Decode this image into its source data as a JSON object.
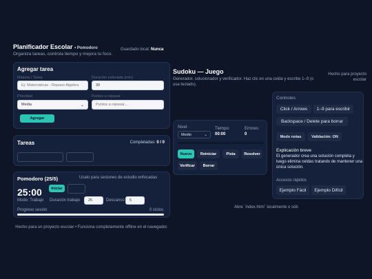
{
  "planner": {
    "title": "Planificador Escolar",
    "subtitle_tag": "• Pomodoro",
    "tagline": "Organiza tareas, controla tiempo y mejora tu foco.",
    "saved_label": "Guardado local:",
    "saved_value": "Nunca"
  },
  "add_task": {
    "heading": "Agregar tarea",
    "subject_label": "Materia / Tarea",
    "subject_placeholder": "Ej: Matemáticas - Repaso Algebra",
    "duration_label": "Duración estimada (min)",
    "duration_value": "30",
    "priority_label": "Prioridad",
    "priority_value": "Media",
    "points_label": "Puntos a repasar",
    "points_placeholder": "Puntos a repasar...",
    "add_button": "Agregar"
  },
  "tasks": {
    "heading": "Tareas",
    "completed_label": "Completadas:",
    "completed_value": "0 / 0"
  },
  "pomodoro": {
    "heading": "Pomodoro (25/5)",
    "note": "Usalo para sesiones de estudio enfocadas",
    "time": "25:00",
    "start_button": "Iniciar",
    "mode_label": "Modo: Trabajo",
    "work_label": "Duración trabajo",
    "work_value": "25",
    "rest_label": "Descanso",
    "rest_value": "5",
    "progress_label": "Progreso sesión",
    "cycles": "0 ciclos",
    "progress": 0
  },
  "footer": {
    "left": "Hecho para un proyecto escolar • Funciona completamente offline en el navegador.",
    "right": "Abre `index.html` localmente o sób"
  },
  "sudoku": {
    "title": "Sudoku — Juego",
    "description": "Generador, solucionador y verificador. Haz clic en una celda y escribe 1–9 (o usa teclado).",
    "made_for": "Hecho para proyecto escolar",
    "level_label": "Nivel:",
    "level_value": "Medio",
    "time_label": "Tiempo:",
    "time_value": "00:00",
    "errors_label": "Errores:",
    "errors_value": "0",
    "buttons": {
      "new": "Nuevo",
      "restart": "Reiniciar",
      "hint": "Pista",
      "solve": "Resolver",
      "verify": "Verificar",
      "clear": "Borrar"
    }
  },
  "controls": {
    "heading": "Controles",
    "click": "Click / Arrows",
    "write": "1–9 para escribir",
    "backspace": "Backspace / Delete para borrar",
    "notes_mode": "Modo notas",
    "validation": "Validación: ON",
    "expl_heading": "Explicación breve",
    "expl_text": "El generador crea una solución completa y luego elimina celdas tratando de mantener una única solución.",
    "shortcuts_heading": "Accesos rápidos",
    "easy": "Ejemplo Fácil",
    "hard": "Ejemplo Difícil"
  },
  "colors": {
    "accent": "#2bc5b4",
    "background": "#0d1526",
    "panel": "#15203a"
  }
}
